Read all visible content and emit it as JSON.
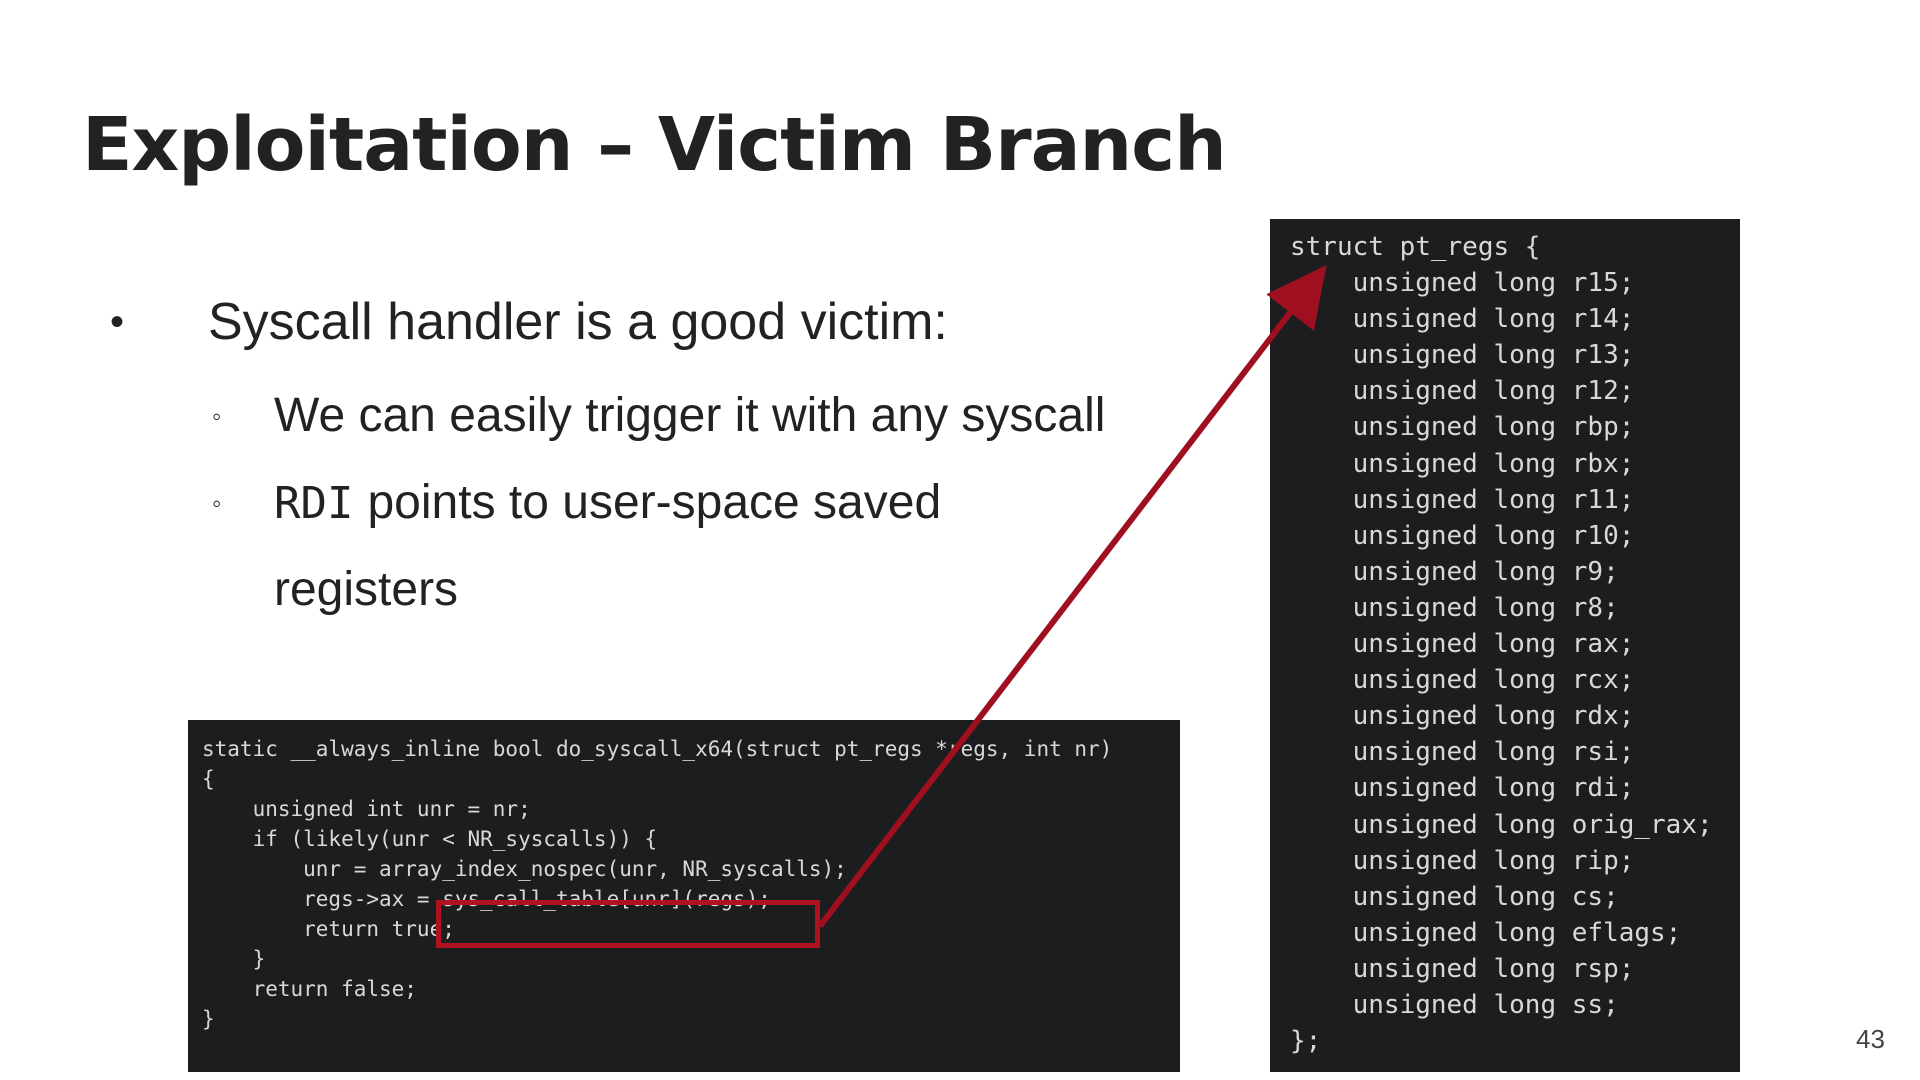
{
  "slide": {
    "title": "Exploitation – Victim Branch",
    "page_number": "43"
  },
  "bullets": {
    "main": {
      "marker": "•",
      "text": "Syscall handler is a good victim:"
    },
    "sub": [
      {
        "marker": "◦",
        "text": "We can easily trigger it with any syscall"
      },
      {
        "marker": "◦",
        "code": "RDI",
        "text": "points to user-space saved registers"
      }
    ]
  },
  "code_left": {
    "lines": [
      "static __always_inline bool do_syscall_x64(struct pt_regs *regs, int nr)",
      "{",
      "    unsigned int unr = nr;",
      "",
      "    if (likely(unr < NR_syscalls)) {",
      "        unr = array_index_nospec(unr, NR_syscalls);",
      "        regs->ax = sys_call_table[unr](regs);",
      "        return true;",
      "    }",
      "    return false;",
      "}"
    ],
    "highlight": "sys_call_table[unr](regs);"
  },
  "code_right": {
    "lines": [
      "struct pt_regs {",
      "    unsigned long r15;",
      "    unsigned long r14;",
      "    unsigned long r13;",
      "    unsigned long r12;",
      "    unsigned long rbp;",
      "    unsigned long rbx;",
      "    unsigned long r11;",
      "    unsigned long r10;",
      "    unsigned long r9;",
      "    unsigned long r8;",
      "    unsigned long rax;",
      "    unsigned long rcx;",
      "    unsigned long rdx;",
      "    unsigned long rsi;",
      "    unsigned long rdi;",
      "    unsigned long orig_rax;",
      "    unsigned long rip;",
      "    unsigned long cs;",
      "    unsigned long eflags;",
      "    unsigned long rsp;",
      "    unsigned long ss;",
      "};"
    ]
  },
  "colors": {
    "arrow": "#9e0f1f",
    "highlight_border": "#b01222",
    "code_background": "#1c1d1e"
  }
}
